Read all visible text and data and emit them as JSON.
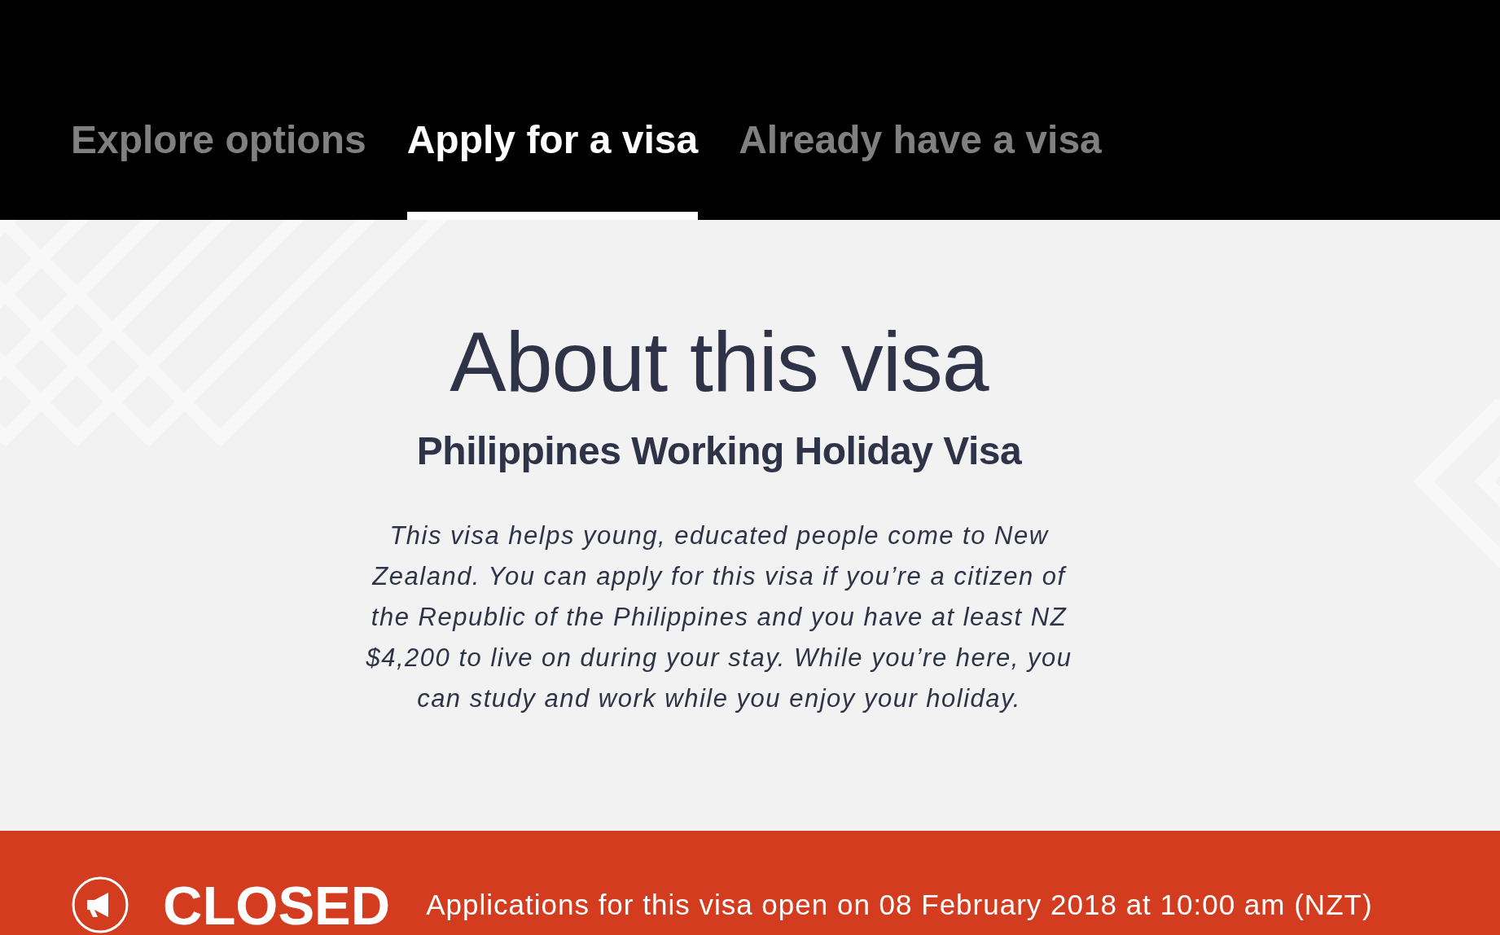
{
  "nav": {
    "tabs": [
      {
        "label": "Explore options",
        "selected": false
      },
      {
        "label": "Apply for a visa",
        "selected": true
      },
      {
        "label": "Already have a visa",
        "selected": false
      }
    ]
  },
  "intro": {
    "title": "About this visa",
    "subtitle": "Philippines Working Holiday Visa",
    "description": "This visa helps young, educated people come to New Zealand. You can apply for this visa if you’re a citizen of the Republic of the Philippines and you have at least NZ $4,200 to live on during your stay. While you’re here, you can study and work while you enjoy your holiday."
  },
  "status_banner": {
    "status": "CLOSED",
    "message": "Applications for this visa open on 08 February 2018 at 10:00 am (NZT)"
  }
}
